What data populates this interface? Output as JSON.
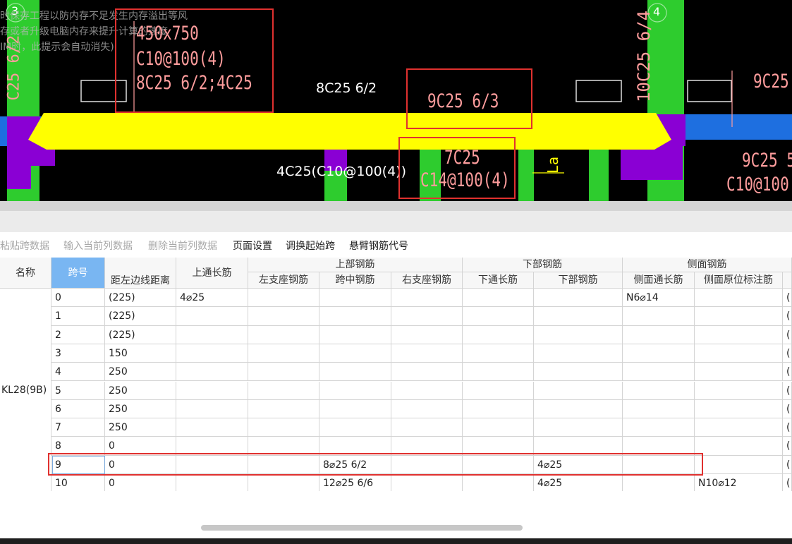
{
  "cad": {
    "axis_label_left": "3",
    "axis_label_right": "4",
    "hint_lines": [
      "时保存工程以防内存不足发生内存溢出等风",
      "存或者升级电脑内存来提升计算的速度",
      "IM时，此提示会自动消失)"
    ],
    "beam_section": "450x750",
    "stirrup": "C10@100(4)",
    "top_bars": "8C25 6/2;4C25",
    "mid_top_white": "8C25 6/2",
    "mid_top_red": "9C25 6/3",
    "vertical_left": "C25 6/2",
    "vertical_right": "10C25 6/4",
    "right_top": "9C25",
    "bottom_white": "4C25(C10@100(4))",
    "bottom_red_line1": "7C25",
    "bottom_red_line2": "C14@100(4)",
    "la_label": "La",
    "right_bottom_line1": "9C25 5",
    "right_bottom_line2": "C10@100("
  },
  "toolbar": [
    {
      "label": "粘贴跨数据",
      "enabled": false
    },
    {
      "label": "输入当前列数据",
      "enabled": false
    },
    {
      "label": "删除当前列数据",
      "enabled": false
    },
    {
      "label": "页面设置",
      "enabled": true
    },
    {
      "label": "调换起始跨",
      "enabled": true
    },
    {
      "label": "悬臂钢筋代号",
      "enabled": true
    }
  ],
  "table": {
    "headers": {
      "name": "名称",
      "span": "跨号",
      "dist": "距左边线距离",
      "top_long": "上通长筋",
      "top_group": "上部钢筋",
      "left_support": "左支座钢筋",
      "mid_span": "跨中钢筋",
      "right_support": "右支座钢筋",
      "bottom_group": "下部钢筋",
      "bottom_long": "下通长筋",
      "bottom_bars": "下部钢筋",
      "side_group": "侧面钢筋",
      "side_long": "侧面通长筋",
      "side_orig": "侧面原位标注筋"
    },
    "name_value": "KL28(9B)",
    "rows": [
      {
        "span": "0",
        "dist": "(225)",
        "top_long": "4⌀25",
        "left_support": "",
        "mid_span": "",
        "right_support": "",
        "bottom_long": "",
        "bottom_bars": "",
        "side_long": "N6⌀14",
        "side_orig": "",
        "edge": "("
      },
      {
        "span": "1",
        "dist": "(225)",
        "top_long": "",
        "left_support": "",
        "mid_span": "",
        "right_support": "",
        "bottom_long": "",
        "bottom_bars": "",
        "side_long": "",
        "side_orig": "",
        "edge": "("
      },
      {
        "span": "2",
        "dist": "(225)",
        "top_long": "",
        "left_support": "",
        "mid_span": "",
        "right_support": "",
        "bottom_long": "",
        "bottom_bars": "",
        "side_long": "",
        "side_orig": "",
        "edge": "("
      },
      {
        "span": "3",
        "dist": "150",
        "top_long": "",
        "left_support": "",
        "mid_span": "",
        "right_support": "",
        "bottom_long": "",
        "bottom_bars": "",
        "side_long": "",
        "side_orig": "",
        "edge": "("
      },
      {
        "span": "4",
        "dist": "250",
        "top_long": "",
        "left_support": "",
        "mid_span": "",
        "right_support": "",
        "bottom_long": "",
        "bottom_bars": "",
        "side_long": "",
        "side_orig": "",
        "edge": "("
      },
      {
        "span": "5",
        "dist": "250",
        "top_long": "",
        "left_support": "",
        "mid_span": "",
        "right_support": "",
        "bottom_long": "",
        "bottom_bars": "",
        "side_long": "",
        "side_orig": "",
        "edge": "("
      },
      {
        "span": "6",
        "dist": "250",
        "top_long": "",
        "left_support": "",
        "mid_span": "",
        "right_support": "",
        "bottom_long": "",
        "bottom_bars": "",
        "side_long": "",
        "side_orig": "",
        "edge": "("
      },
      {
        "span": "7",
        "dist": "250",
        "top_long": "",
        "left_support": "",
        "mid_span": "",
        "right_support": "",
        "bottom_long": "",
        "bottom_bars": "",
        "side_long": "",
        "side_orig": "",
        "edge": "("
      },
      {
        "span": "8",
        "dist": "0",
        "top_long": "",
        "left_support": "",
        "mid_span": "",
        "right_support": "",
        "bottom_long": "",
        "bottom_bars": "",
        "side_long": "",
        "side_orig": "",
        "edge": "("
      },
      {
        "span": "9",
        "dist": "0",
        "top_long": "",
        "left_support": "",
        "mid_span": "8⌀25 6/2",
        "right_support": "",
        "bottom_long": "",
        "bottom_bars": "4⌀25",
        "side_long": "",
        "side_orig": "",
        "edge": "("
      },
      {
        "span": "10",
        "dist": "0",
        "top_long": "",
        "left_support": "",
        "mid_span": "12⌀25 6/6",
        "right_support": "",
        "bottom_long": "",
        "bottom_bars": "4⌀25",
        "side_long": "",
        "side_orig": "N10⌀12",
        "edge": "("
      }
    ]
  },
  "colors": {
    "cad_background": "#000000",
    "beam_yellow": "#ffff00",
    "column_green": "#2ecc2e",
    "support_purple": "#8a00d4",
    "beam_blue": "#1e6fe0",
    "annotation_red": "#ff9d9d",
    "highlight_box": "#e0312f",
    "selected_header": "#79b6f2"
  }
}
